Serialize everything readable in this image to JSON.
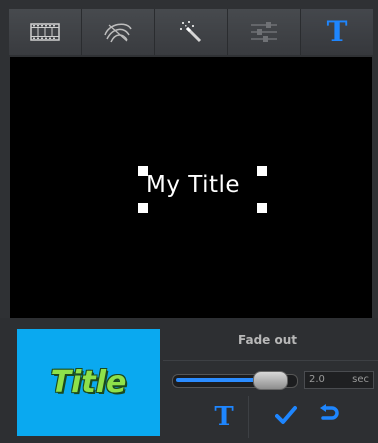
{
  "toolbar": {
    "tools": [
      {
        "icon": "film-strip-icon"
      },
      {
        "icon": "transition-swirl-icon"
      },
      {
        "icon": "magic-wand-icon"
      },
      {
        "icon": "adjust-sliders-icon"
      },
      {
        "icon": "title-text-icon",
        "glyph": "T",
        "active": true
      }
    ]
  },
  "preview": {
    "title_text": "My Title"
  },
  "panel": {
    "thumbnail_text": "Title",
    "effect_label": "Fade out",
    "duration_value": "2.0",
    "duration_unit": "sec",
    "slider_level": 0.75,
    "actions": {
      "text_glyph": "T",
      "confirm_icon": "checkmark-icon",
      "undo_icon": "undo-arrow-icon"
    }
  },
  "colors": {
    "accent": "#1e86ff",
    "thumbnail_bg": "#0aa9f0",
    "thumbnail_text": "#8ee14a"
  }
}
